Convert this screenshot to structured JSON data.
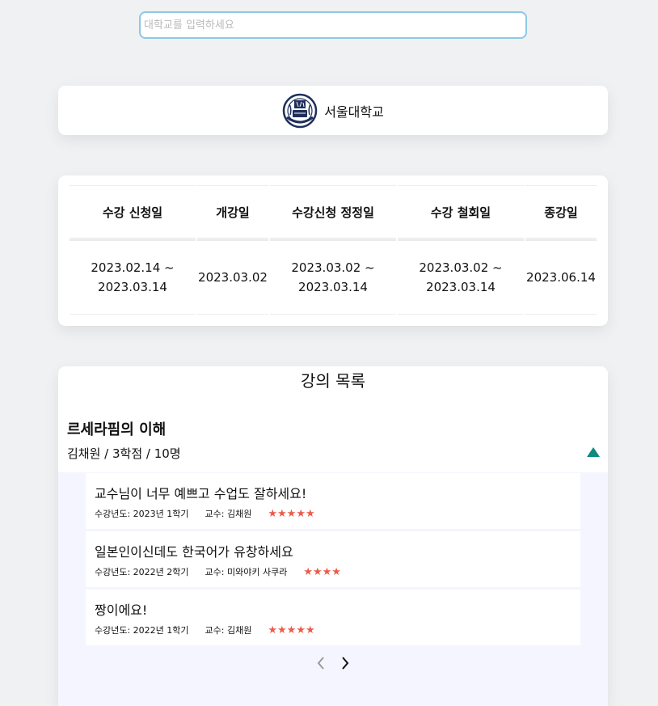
{
  "search": {
    "placeholder": "대학교를 입력하세요",
    "value": ""
  },
  "university": {
    "name": "서울대학교",
    "logo_icon": "snu-emblem-icon"
  },
  "schedule": {
    "headers": [
      "수강 신청일",
      "개강일",
      "수강신청 정정일",
      "수강 철회일",
      "종강일"
    ],
    "cells": [
      {
        "line1": "2023.02.14 ~",
        "line2": "2023.03.14"
      },
      {
        "line1": "2023.03.02",
        "line2": ""
      },
      {
        "line1": "2023.03.02 ~",
        "line2": "2023.03.14"
      },
      {
        "line1": "2023.03.02 ~",
        "line2": "2023.03.14"
      },
      {
        "line1": "2023.06.14",
        "line2": ""
      }
    ]
  },
  "course_list": {
    "heading": "강의 목록",
    "course": {
      "name": "르세라핌의 이해",
      "meta": "김채원 / 3학점 / 10명",
      "collapse_icon": "triangle-up-icon",
      "accent_color": "#0e8a7e"
    },
    "reviews": [
      {
        "text": "교수님이 너무 예쁘고 수업도 잘하세요!",
        "year": "수강년도: 2023년 1학기",
        "professor": "교수: 김채원",
        "stars": "★★★★★",
        "rating": 5
      },
      {
        "text": "일본인이신데도 한국어가 유창하세요",
        "year": "수강년도: 2022년 2학기",
        "professor": "교수: 미와야키 사쿠라",
        "stars": "★★★★",
        "rating": 4
      },
      {
        "text": "짱이에요!",
        "year": "수강년도: 2022년 1학기",
        "professor": "교수: 김채원",
        "stars": "★★★★★",
        "rating": 5
      }
    ],
    "star_color": "#ec5a4a",
    "pager": {
      "prev_icon": "chevron-left-icon",
      "next_icon": "chevron-right-icon"
    }
  }
}
